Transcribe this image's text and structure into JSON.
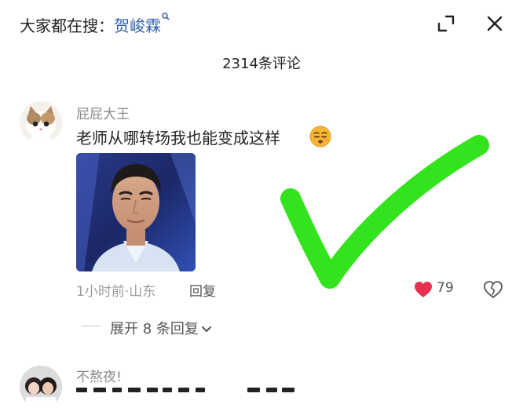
{
  "header": {
    "search_prefix": "大家都在搜：",
    "search_keyword": "贺峻霖",
    "icons": [
      "search-icon",
      "expand-icon",
      "close-icon"
    ]
  },
  "comment_count": "2314条评论",
  "comments": [
    {
      "username": "屁屁大王",
      "text": "老师从哪转场我也能变成这样",
      "emoji": "smirk-emoji",
      "time_location": "1小时前·山东",
      "reply_label": "回复",
      "likes": "79",
      "expand_replies": "展开 8 条回复"
    },
    {
      "username": "不熬夜!"
    }
  ],
  "colors": {
    "keyword": "#2f5fa8",
    "like": "#e8314f",
    "checkmark": "#33e31d"
  }
}
